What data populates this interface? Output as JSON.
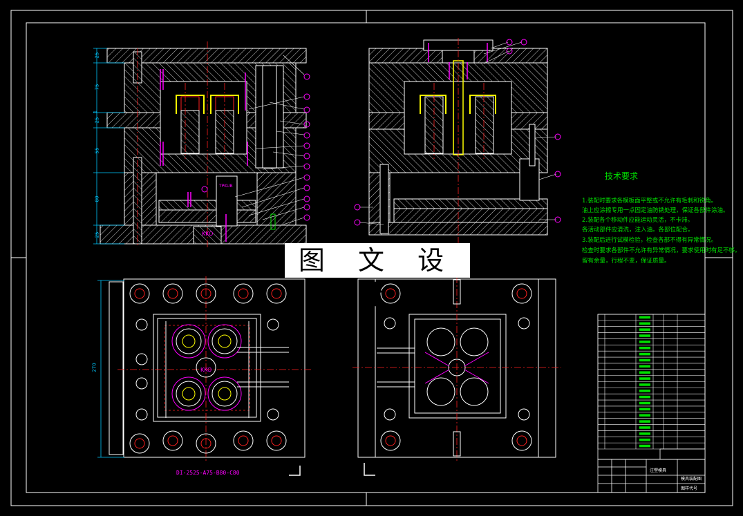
{
  "watermark": "图 文 设 计",
  "tech_req": {
    "title": "技术要求",
    "lines": [
      "1.装配时要求各模板面平整或不允许有毛刺和锐角。",
      "油上应涂擦专用一点固定油防锈处理，保证各部件涂油。",
      "2.装配各个移动件应能运动灵活，不卡滞。",
      "各活动部件应清洗，注入油。各部位配合。",
      "3.装配后进行试模检验，检查各部不得有异常情况。",
      "检查时要求各部件不允许有异常情况，要求使用时有足不够。",
      "留有余量，行程不变，保证质量。"
    ]
  },
  "part_number": "DI-2525-A75-B80-C80",
  "insert_labels": {
    "upper": "KKO",
    "lower": "KKO"
  },
  "ejector_label": "TPKUB",
  "dimensions": {
    "left_dims": [
      "25",
      "75",
      "1",
      "25",
      "55",
      "80",
      "25"
    ],
    "plan_height": "270"
  },
  "balloons_left": [
    "1",
    "2",
    "3",
    "4",
    "5",
    "6",
    "7",
    "8",
    "9",
    "10",
    "11",
    "12",
    "13",
    "14",
    "15",
    "16",
    "17"
  ],
  "balloons_right": [
    "18",
    "19",
    "20",
    "21",
    "22",
    "23",
    "24",
    "25"
  ],
  "title_block": {
    "drawing_title": "注塑模具",
    "name_label": "模具装配图",
    "code_label": "图样代号"
  },
  "colors": {
    "background": "#000000",
    "outline": "#ffffff",
    "hatch": "#c8c8c8",
    "centerline": "#ff2020",
    "cavity": "#ffff00",
    "dimension": "#00c8ff",
    "balloon": "#ff00ff",
    "bolt": "#ff00ff",
    "table_text": "#00e000"
  },
  "bom_rows": 22
}
